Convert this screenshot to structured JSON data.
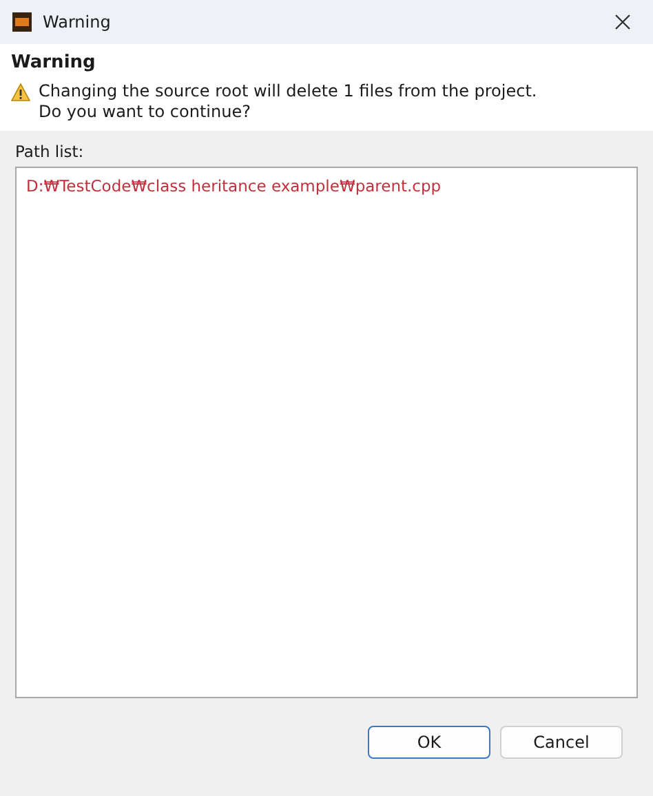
{
  "window": {
    "title": "Warning"
  },
  "header": {
    "title": "Warning",
    "message": "Changing the source root will delete 1 files from the project. Do you want to continue?"
  },
  "path_list": {
    "label": "Path list:",
    "items": [
      "D:₩TestCode₩class heritance example₩parent.cpp"
    ]
  },
  "buttons": [
    {
      "label": "OK",
      "default": true
    },
    {
      "label": "Cancel",
      "default": false
    }
  ]
}
